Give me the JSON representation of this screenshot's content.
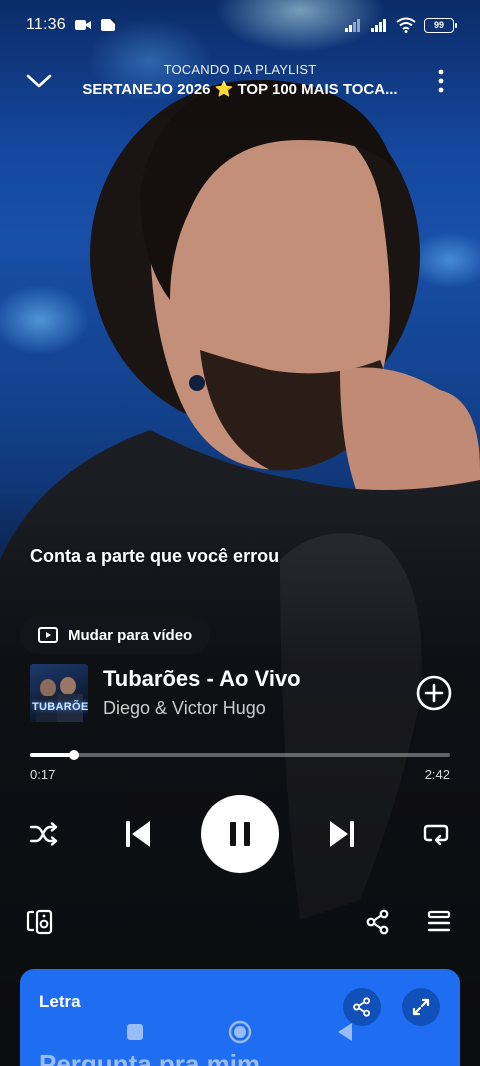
{
  "status_bar": {
    "time": "11:36",
    "battery": "99"
  },
  "header": {
    "subtitle": "TOCANDO DA PLAYLIST",
    "playlist_title": "SERTANEJO 2026 ⭐ TOP 100 MAIS TOCA..."
  },
  "lyric_line": "Conta a parte que você errou",
  "video_toggle": {
    "label": "Mudar para vídeo"
  },
  "track": {
    "cover_text": "TUBARÕES",
    "title": "Tubarões - Ao Vivo",
    "artist": "Diego & Victor Hugo"
  },
  "progress": {
    "elapsed": "0:17",
    "total": "2:42",
    "fraction": 0.105
  },
  "lyrics_card": {
    "label": "Letra",
    "first_line": "Pergunta pra mim",
    "background": "#1f6df0"
  },
  "colors": {
    "accent": "#1f6df0",
    "text": "#ffffff"
  },
  "icons": {
    "collapse": "chevron-down-icon",
    "more": "more-vertical-icon",
    "add": "plus-circle-icon",
    "shuffle": "shuffle-icon",
    "previous": "skip-previous-icon",
    "pause": "pause-icon",
    "next": "skip-next-icon",
    "repeat": "repeat-icon",
    "devices": "speaker-devices-icon",
    "share": "share-icon",
    "queue": "queue-icon",
    "expand": "expand-icon"
  }
}
